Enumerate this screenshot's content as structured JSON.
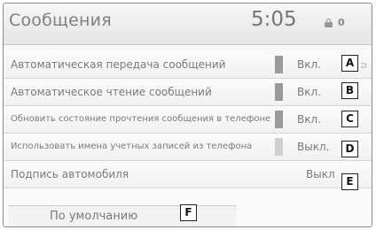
{
  "header": {
    "title": "Сообщения",
    "time": "5:05",
    "status_signal": "0",
    "lock_icon": "lock-icon"
  },
  "settings": [
    {
      "label": "Автоматическая передача сообщений",
      "value": "Вкл.",
      "callout": "A"
    },
    {
      "label": "Автоматическое чтение сообщений",
      "value": "Вкл.",
      "callout": "B"
    },
    {
      "label": "Обновить состояние прочтения сообщения в телефоне",
      "value": "Вкл.",
      "callout": "C"
    },
    {
      "label": "Использовать имена учетных записей из телефона",
      "value": "Выкл.",
      "callout": "D"
    },
    {
      "label": "Подпись автомобиля",
      "value": "Выкл",
      "callout": "E"
    }
  ],
  "default_button": {
    "label": "По умолчанию",
    "callout": "F"
  },
  "colors": {
    "text": "#7a7a7a",
    "indicator_on": "#9a9a9a",
    "indicator_off": "#cfcfcf"
  }
}
